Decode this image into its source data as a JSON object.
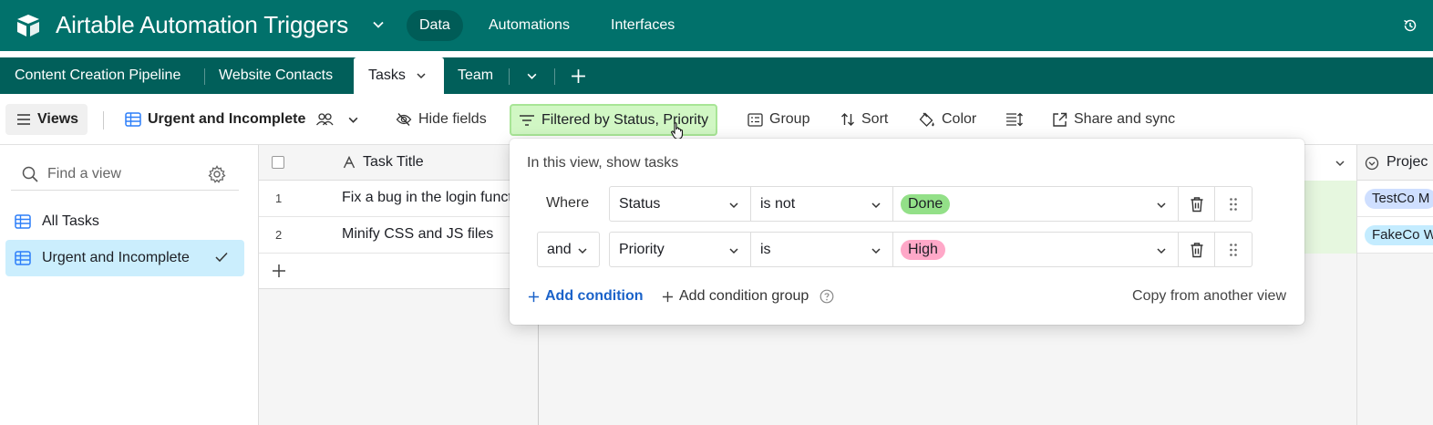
{
  "header": {
    "base_title": "Airtable Automation Triggers",
    "nav": [
      "Data",
      "Automations",
      "Interfaces"
    ],
    "active_nav": "Data"
  },
  "tabs": {
    "items": [
      "Content Creation Pipeline",
      "Website Contacts",
      "Tasks",
      "Team"
    ],
    "active": "Tasks"
  },
  "toolbar": {
    "views_label": "Views",
    "view_name": "Urgent and Incomplete",
    "hide_fields": "Hide fields",
    "filter_label": "Filtered by Status, Priority",
    "group": "Group",
    "sort": "Sort",
    "color": "Color",
    "share": "Share and sync"
  },
  "sidebar": {
    "search_placeholder": "Find a view",
    "items": [
      {
        "label": "All Tasks",
        "active": false
      },
      {
        "label": "Urgent and Incomplete",
        "active": true
      }
    ]
  },
  "grid": {
    "primary_header": "Task Title",
    "right_header": "Projec",
    "rows": [
      {
        "num": "1",
        "title": "Fix a bug in the login functionality",
        "project": "TestCo M"
      },
      {
        "num": "2",
        "title": "Minify CSS and JS files",
        "project": "FakeCo W"
      }
    ]
  },
  "filter": {
    "title": "In this view, show tasks",
    "conditions": [
      {
        "conjunction": "Where",
        "field": "Status",
        "operator": "is not",
        "value": "Done",
        "value_color": "#93e088"
      },
      {
        "conjunction": "and",
        "field": "Priority",
        "operator": "is",
        "value": "High",
        "value_color": "#ffa8c8"
      }
    ],
    "add_condition": "Add condition",
    "add_group": "Add condition group",
    "copy": "Copy from another view"
  },
  "colors": {
    "header_bg": "#01716b",
    "tab_bg": "#015f5a",
    "filter_active_bg": "#d1f7c4",
    "link_blue": "#1a62c9",
    "selected_view_bg": "#cbeefd"
  }
}
